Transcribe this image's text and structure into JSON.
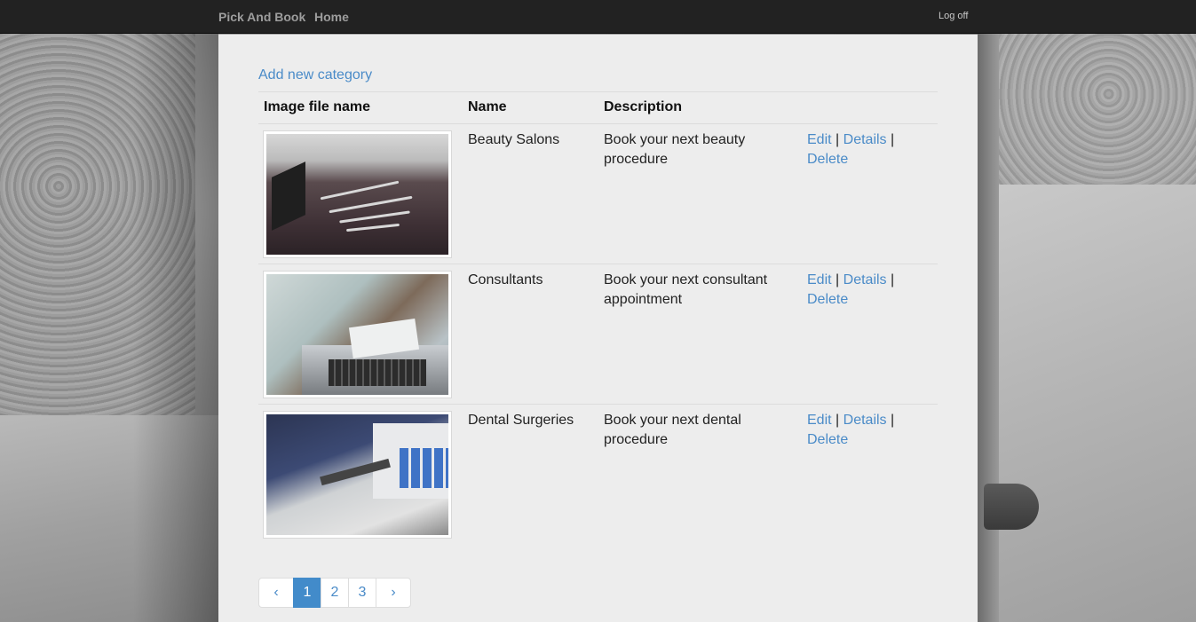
{
  "navbar": {
    "brand": "Pick And Book",
    "home_label": "Home",
    "logoff_label": "Log off"
  },
  "content": {
    "add_link": "Add new category",
    "table": {
      "headers": [
        "Image file name",
        "Name",
        "Description",
        ""
      ],
      "rows": [
        {
          "image_icon": "beauty-salon-photo",
          "name": "Beauty Salons",
          "description": "Book your next beauty procedure",
          "edit": "Edit",
          "details": "Details",
          "delete": "Delete"
        },
        {
          "image_icon": "consultant-photo",
          "name": "Consultants",
          "description": "Book your next consultant appointment",
          "edit": "Edit",
          "details": "Details",
          "delete": "Delete"
        },
        {
          "image_icon": "dental-surgery-photo",
          "name": "Dental Surgeries",
          "description": "Book your next dental procedure",
          "edit": "Edit",
          "details": "Details",
          "delete": "Delete"
        }
      ],
      "separator": "|"
    },
    "pagination": {
      "prev_icon": "chevron-left-icon",
      "next_icon": "chevron-right-icon",
      "prev_glyph": "‹",
      "next_glyph": "›",
      "pages": [
        "1",
        "2",
        "3"
      ],
      "active_page": "1"
    }
  },
  "colors": {
    "navbar_bg": "#222222",
    "panel_bg": "#ededed",
    "link": "#4a8bc8",
    "active_page": "#428bca"
  }
}
